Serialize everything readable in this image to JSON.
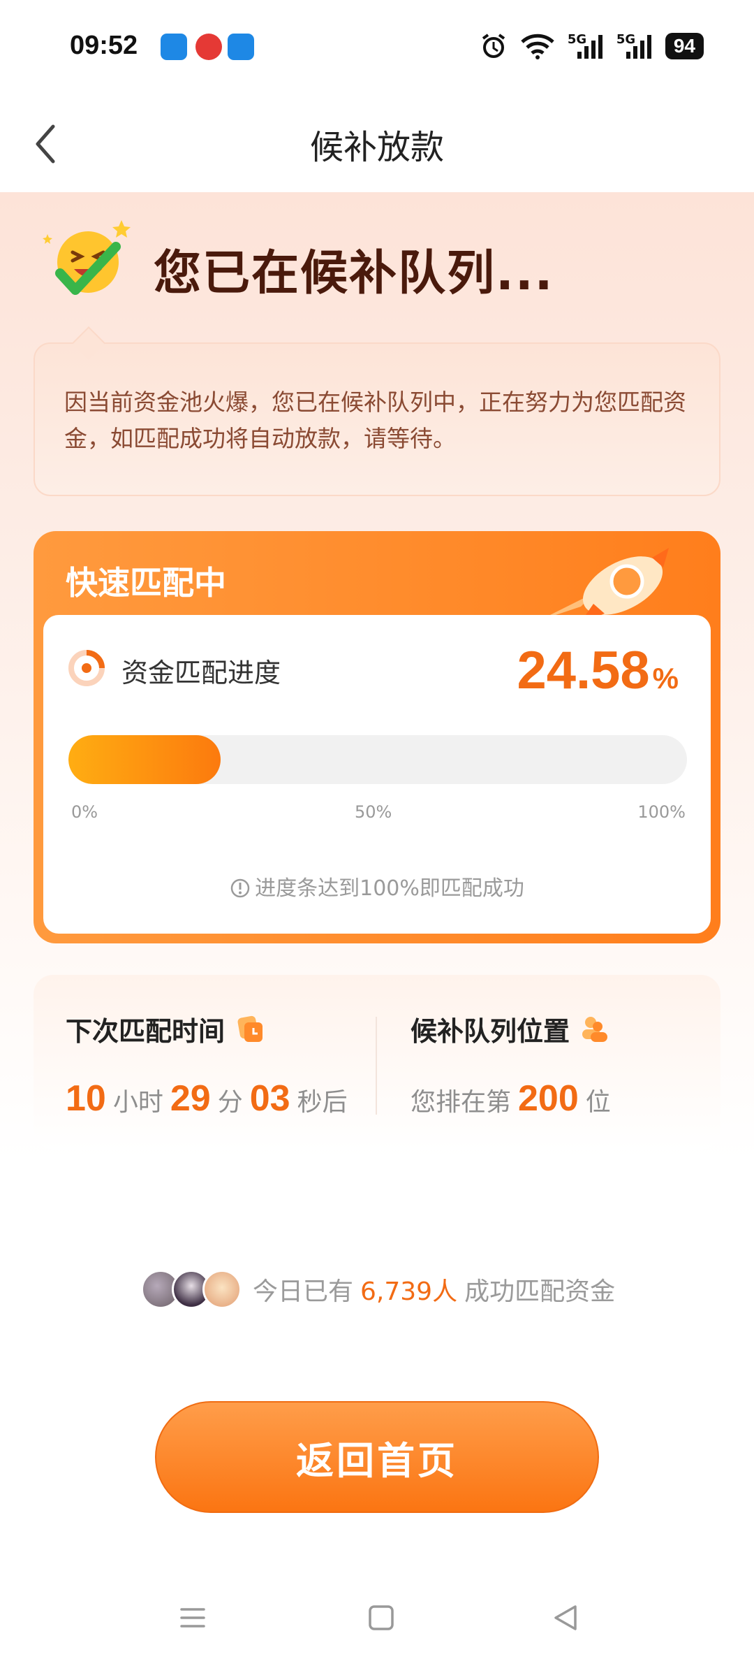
{
  "status_bar": {
    "time": "09:52",
    "signal_label_1": "5G",
    "signal_label_2": "5G",
    "battery": "94"
  },
  "header": {
    "title": "候补放款"
  },
  "hero": {
    "title": "您已在候补队列..."
  },
  "notice": {
    "text": "因当前资金池火爆，您已在候补队列中，正在努力为您匹配资金，如匹配成功将自动放款，请等待。"
  },
  "match_card": {
    "title": "快速匹配中",
    "progress_label": "资金匹配进度",
    "progress_value": "24.58",
    "progress_unit": "%",
    "progress_fraction": 0.2458,
    "ticks": [
      "0%",
      "50%",
      "100%"
    ],
    "hint": "进度条达到100%即匹配成功"
  },
  "next_match": {
    "heading": "下次匹配时间",
    "hours": "10",
    "hours_unit": "小时",
    "minutes": "29",
    "minutes_unit": "分",
    "seconds": "03",
    "seconds_unit": "秒后"
  },
  "queue": {
    "heading": "候补队列位置",
    "prefix": "您排在第",
    "position": "200",
    "suffix": "位"
  },
  "social": {
    "prefix": "今日已有",
    "count": "6,739人",
    "suffix": "成功匹配资金"
  },
  "actions": {
    "home_label": "返回首页"
  },
  "colors": {
    "accent": "#f26b14",
    "progress_start": "#ffad12",
    "progress_end": "#fc7a0e"
  }
}
